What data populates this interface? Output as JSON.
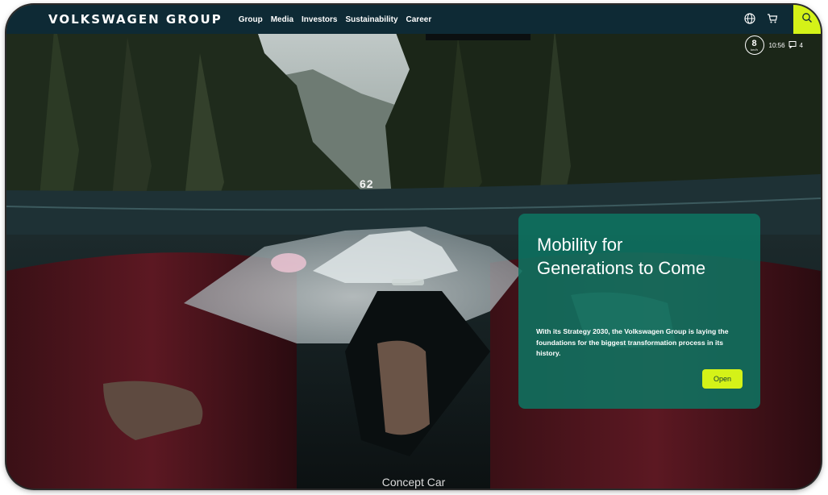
{
  "header": {
    "logo": "VOLKSWAGEN GROUP",
    "nav": [
      "Group",
      "Media",
      "Investors",
      "Sustainability",
      "Career"
    ],
    "icons": [
      "globe-icon",
      "cart-icon",
      "search-icon"
    ]
  },
  "hud": {
    "speed": "62",
    "range_number": "8",
    "range_unit": "km/h",
    "time": "10:56",
    "count": "4"
  },
  "card": {
    "title": "Mobility for\nGenerations to Come",
    "body": "With its Strategy 2030, the Volkswagen Group is laying the foundations for the biggest transformation process in its history.",
    "button": "Open"
  },
  "caption": "Concept Car",
  "colors": {
    "topbar": "#0e2a35",
    "accent": "#d4f218",
    "card": "#0d7462"
  }
}
